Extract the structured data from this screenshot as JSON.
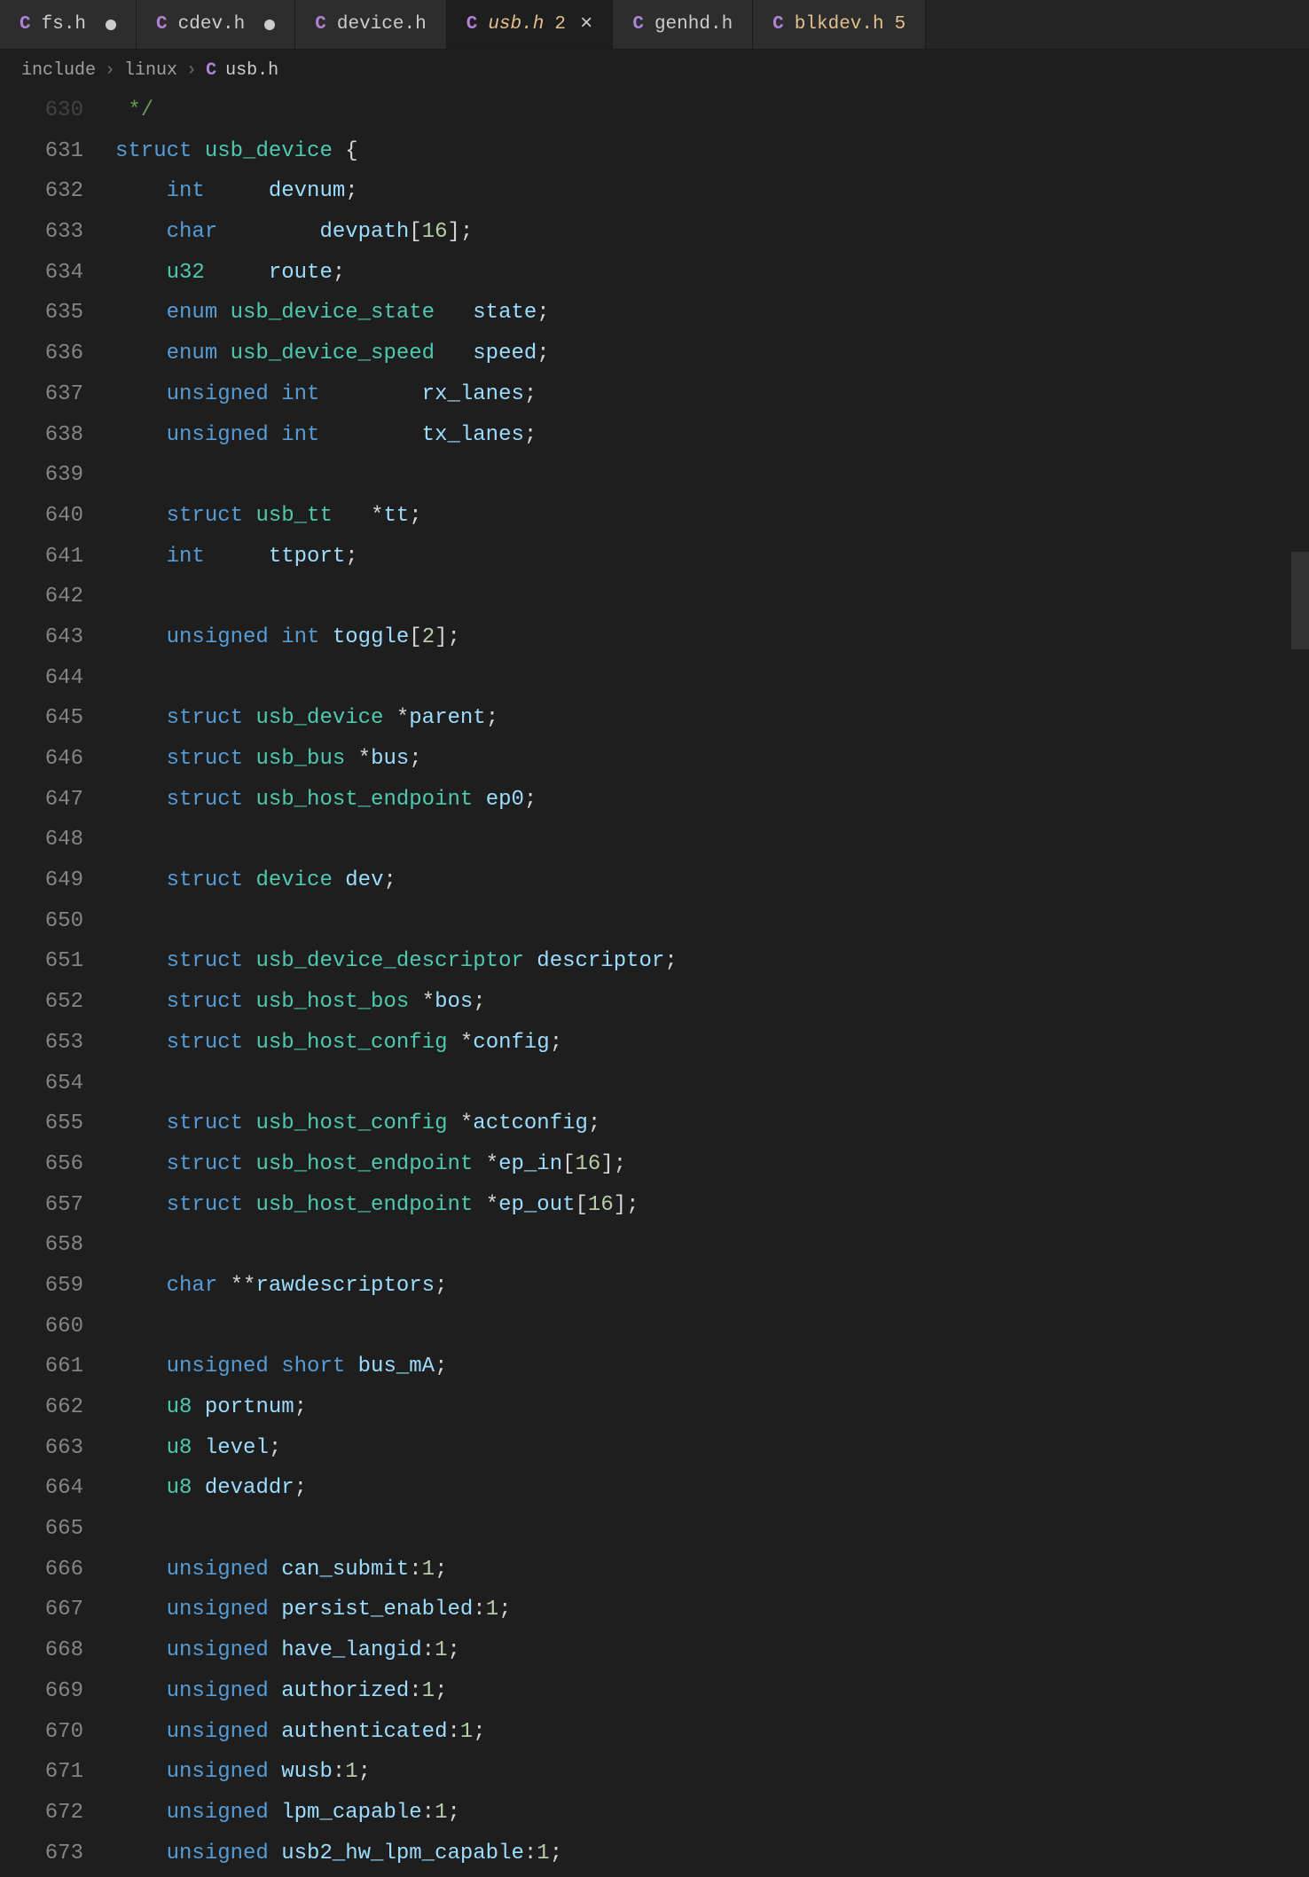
{
  "tabs": [
    {
      "icon": "C",
      "name": "fs.h",
      "modified": true,
      "badge": "",
      "active": false,
      "close": false
    },
    {
      "icon": "C",
      "name": "cdev.h",
      "modified": true,
      "badge": "",
      "active": false,
      "close": false
    },
    {
      "icon": "C",
      "name": "device.h",
      "modified": false,
      "badge": "",
      "active": false,
      "close": false
    },
    {
      "icon": "C",
      "name": "usb.h",
      "modified": false,
      "badge": "2",
      "active": true,
      "close": true
    },
    {
      "icon": "C",
      "name": "genhd.h",
      "modified": false,
      "badge": "",
      "active": false,
      "close": false
    },
    {
      "icon": "C",
      "name": "blkdev.h",
      "modified": false,
      "badge": "5",
      "active": false,
      "close": false
    }
  ],
  "breadcrumbs": {
    "part0": "include",
    "part1": "linux",
    "fileIcon": "C",
    "file": "usb.h",
    "sep": "›"
  },
  "lineStart": 630,
  "code": [
    {
      "n": 630,
      "faded": true,
      "tokens": [
        [
          "comment",
          " */"
        ]
      ]
    },
    {
      "n": 631,
      "tokens": [
        [
          "kw",
          "struct"
        ],
        [
          "sp",
          " "
        ],
        [
          "type",
          "usb_device"
        ],
        [
          "sp",
          " "
        ],
        [
          "punc",
          "{"
        ]
      ]
    },
    {
      "n": 632,
      "indent": 1,
      "tokens": [
        [
          "kw",
          "int"
        ],
        [
          "sp",
          "     "
        ],
        [
          "field",
          "devnum"
        ],
        [
          "punc",
          ";"
        ]
      ]
    },
    {
      "n": 633,
      "indent": 1,
      "tokens": [
        [
          "kw",
          "char"
        ],
        [
          "sp",
          "        "
        ],
        [
          "field",
          "devpath"
        ],
        [
          "punc",
          "["
        ],
        [
          "num",
          "16"
        ],
        [
          "punc",
          "]"
        ],
        [
          "punc",
          ";"
        ]
      ]
    },
    {
      "n": 634,
      "indent": 1,
      "tokens": [
        [
          "typealias",
          "u32"
        ],
        [
          "sp",
          "     "
        ],
        [
          "field",
          "route"
        ],
        [
          "punc",
          ";"
        ]
      ]
    },
    {
      "n": 635,
      "indent": 1,
      "tokens": [
        [
          "kw",
          "enum"
        ],
        [
          "sp",
          " "
        ],
        [
          "type",
          "usb_device_state"
        ],
        [
          "sp",
          "   "
        ],
        [
          "field",
          "state"
        ],
        [
          "punc",
          ";"
        ]
      ]
    },
    {
      "n": 636,
      "indent": 1,
      "tokens": [
        [
          "kw",
          "enum"
        ],
        [
          "sp",
          " "
        ],
        [
          "type",
          "usb_device_speed"
        ],
        [
          "sp",
          "   "
        ],
        [
          "field",
          "speed"
        ],
        [
          "punc",
          ";"
        ]
      ]
    },
    {
      "n": 637,
      "indent": 1,
      "tokens": [
        [
          "kw",
          "unsigned"
        ],
        [
          "sp",
          " "
        ],
        [
          "kw",
          "int"
        ],
        [
          "sp",
          "        "
        ],
        [
          "field",
          "rx_lanes"
        ],
        [
          "punc",
          ";"
        ]
      ]
    },
    {
      "n": 638,
      "indent": 1,
      "tokens": [
        [
          "kw",
          "unsigned"
        ],
        [
          "sp",
          " "
        ],
        [
          "kw",
          "int"
        ],
        [
          "sp",
          "        "
        ],
        [
          "field",
          "tx_lanes"
        ],
        [
          "punc",
          ";"
        ]
      ]
    },
    {
      "n": 639,
      "indent": 1,
      "tokens": []
    },
    {
      "n": 640,
      "indent": 1,
      "tokens": [
        [
          "kw",
          "struct"
        ],
        [
          "sp",
          " "
        ],
        [
          "type",
          "usb_tt"
        ],
        [
          "sp",
          "   "
        ],
        [
          "op",
          "*"
        ],
        [
          "field",
          "tt"
        ],
        [
          "punc",
          ";"
        ]
      ]
    },
    {
      "n": 641,
      "indent": 1,
      "tokens": [
        [
          "kw",
          "int"
        ],
        [
          "sp",
          "     "
        ],
        [
          "field",
          "ttport"
        ],
        [
          "punc",
          ";"
        ]
      ]
    },
    {
      "n": 642,
      "indent": 1,
      "tokens": []
    },
    {
      "n": 643,
      "indent": 1,
      "tokens": [
        [
          "kw",
          "unsigned"
        ],
        [
          "sp",
          " "
        ],
        [
          "kw",
          "int"
        ],
        [
          "sp",
          " "
        ],
        [
          "field",
          "toggle"
        ],
        [
          "punc",
          "["
        ],
        [
          "num",
          "2"
        ],
        [
          "punc",
          "]"
        ],
        [
          "punc",
          ";"
        ]
      ]
    },
    {
      "n": 644,
      "indent": 1,
      "tokens": []
    },
    {
      "n": 645,
      "indent": 1,
      "tokens": [
        [
          "kw",
          "struct"
        ],
        [
          "sp",
          " "
        ],
        [
          "type",
          "usb_device"
        ],
        [
          "sp",
          " "
        ],
        [
          "op",
          "*"
        ],
        [
          "field",
          "parent"
        ],
        [
          "punc",
          ";"
        ]
      ]
    },
    {
      "n": 646,
      "indent": 1,
      "tokens": [
        [
          "kw",
          "struct"
        ],
        [
          "sp",
          " "
        ],
        [
          "type",
          "usb_bus"
        ],
        [
          "sp",
          " "
        ],
        [
          "op",
          "*"
        ],
        [
          "field",
          "bus"
        ],
        [
          "punc",
          ";"
        ]
      ]
    },
    {
      "n": 647,
      "indent": 1,
      "tokens": [
        [
          "kw",
          "struct"
        ],
        [
          "sp",
          " "
        ],
        [
          "type",
          "usb_host_endpoint"
        ],
        [
          "sp",
          " "
        ],
        [
          "field",
          "ep0"
        ],
        [
          "punc",
          ";"
        ]
      ]
    },
    {
      "n": 648,
      "indent": 1,
      "tokens": []
    },
    {
      "n": 649,
      "indent": 1,
      "tokens": [
        [
          "kw",
          "struct"
        ],
        [
          "sp",
          " "
        ],
        [
          "type",
          "device"
        ],
        [
          "sp",
          " "
        ],
        [
          "field",
          "dev"
        ],
        [
          "punc",
          ";"
        ]
      ]
    },
    {
      "n": 650,
      "indent": 1,
      "tokens": []
    },
    {
      "n": 651,
      "indent": 1,
      "tokens": [
        [
          "kw",
          "struct"
        ],
        [
          "sp",
          " "
        ],
        [
          "type",
          "usb_device_descriptor"
        ],
        [
          "sp",
          " "
        ],
        [
          "field",
          "descriptor"
        ],
        [
          "punc",
          ";"
        ]
      ]
    },
    {
      "n": 652,
      "indent": 1,
      "tokens": [
        [
          "kw",
          "struct"
        ],
        [
          "sp",
          " "
        ],
        [
          "type",
          "usb_host_bos"
        ],
        [
          "sp",
          " "
        ],
        [
          "op",
          "*"
        ],
        [
          "field",
          "bos"
        ],
        [
          "punc",
          ";"
        ]
      ]
    },
    {
      "n": 653,
      "indent": 1,
      "tokens": [
        [
          "kw",
          "struct"
        ],
        [
          "sp",
          " "
        ],
        [
          "type",
          "usb_host_config"
        ],
        [
          "sp",
          " "
        ],
        [
          "op",
          "*"
        ],
        [
          "field",
          "config"
        ],
        [
          "punc",
          ";"
        ]
      ]
    },
    {
      "n": 654,
      "indent": 1,
      "tokens": []
    },
    {
      "n": 655,
      "indent": 1,
      "tokens": [
        [
          "kw",
          "struct"
        ],
        [
          "sp",
          " "
        ],
        [
          "type",
          "usb_host_config"
        ],
        [
          "sp",
          " "
        ],
        [
          "op",
          "*"
        ],
        [
          "field",
          "actconfig"
        ],
        [
          "punc",
          ";"
        ]
      ]
    },
    {
      "n": 656,
      "indent": 1,
      "tokens": [
        [
          "kw",
          "struct"
        ],
        [
          "sp",
          " "
        ],
        [
          "type",
          "usb_host_endpoint"
        ],
        [
          "sp",
          " "
        ],
        [
          "op",
          "*"
        ],
        [
          "field",
          "ep_in"
        ],
        [
          "punc",
          "["
        ],
        [
          "num",
          "16"
        ],
        [
          "punc",
          "]"
        ],
        [
          "punc",
          ";"
        ]
      ]
    },
    {
      "n": 657,
      "indent": 1,
      "tokens": [
        [
          "kw",
          "struct"
        ],
        [
          "sp",
          " "
        ],
        [
          "type",
          "usb_host_endpoint"
        ],
        [
          "sp",
          " "
        ],
        [
          "op",
          "*"
        ],
        [
          "field",
          "ep_out"
        ],
        [
          "punc",
          "["
        ],
        [
          "num",
          "16"
        ],
        [
          "punc",
          "]"
        ],
        [
          "punc",
          ";"
        ]
      ]
    },
    {
      "n": 658,
      "indent": 1,
      "tokens": []
    },
    {
      "n": 659,
      "indent": 1,
      "tokens": [
        [
          "kw",
          "char"
        ],
        [
          "sp",
          " "
        ],
        [
          "op",
          "**"
        ],
        [
          "field",
          "rawdescriptors"
        ],
        [
          "punc",
          ";"
        ]
      ]
    },
    {
      "n": 660,
      "indent": 1,
      "tokens": []
    },
    {
      "n": 661,
      "indent": 1,
      "tokens": [
        [
          "kw",
          "unsigned"
        ],
        [
          "sp",
          " "
        ],
        [
          "kw",
          "short"
        ],
        [
          "sp",
          " "
        ],
        [
          "field",
          "bus_mA"
        ],
        [
          "punc",
          ";"
        ]
      ]
    },
    {
      "n": 662,
      "indent": 1,
      "tokens": [
        [
          "typealias",
          "u8"
        ],
        [
          "sp",
          " "
        ],
        [
          "field",
          "portnum"
        ],
        [
          "punc",
          ";"
        ]
      ]
    },
    {
      "n": 663,
      "indent": 1,
      "tokens": [
        [
          "typealias",
          "u8"
        ],
        [
          "sp",
          " "
        ],
        [
          "field",
          "level"
        ],
        [
          "punc",
          ";"
        ]
      ]
    },
    {
      "n": 664,
      "indent": 1,
      "tokens": [
        [
          "typealias",
          "u8"
        ],
        [
          "sp",
          " "
        ],
        [
          "field",
          "devaddr"
        ],
        [
          "punc",
          ";"
        ]
      ]
    },
    {
      "n": 665,
      "indent": 1,
      "tokens": []
    },
    {
      "n": 666,
      "indent": 1,
      "tokens": [
        [
          "kw",
          "unsigned"
        ],
        [
          "sp",
          " "
        ],
        [
          "field",
          "can_submit"
        ],
        [
          "punc",
          ":"
        ],
        [
          "num",
          "1"
        ],
        [
          "punc",
          ";"
        ]
      ]
    },
    {
      "n": 667,
      "indent": 1,
      "tokens": [
        [
          "kw",
          "unsigned"
        ],
        [
          "sp",
          " "
        ],
        [
          "field",
          "persist_enabled"
        ],
        [
          "punc",
          ":"
        ],
        [
          "num",
          "1"
        ],
        [
          "punc",
          ";"
        ]
      ]
    },
    {
      "n": 668,
      "indent": 1,
      "tokens": [
        [
          "kw",
          "unsigned"
        ],
        [
          "sp",
          " "
        ],
        [
          "field",
          "have_langid"
        ],
        [
          "punc",
          ":"
        ],
        [
          "num",
          "1"
        ],
        [
          "punc",
          ";"
        ]
      ]
    },
    {
      "n": 669,
      "indent": 1,
      "tokens": [
        [
          "kw",
          "unsigned"
        ],
        [
          "sp",
          " "
        ],
        [
          "field",
          "authorized"
        ],
        [
          "punc",
          ":"
        ],
        [
          "num",
          "1"
        ],
        [
          "punc",
          ";"
        ]
      ]
    },
    {
      "n": 670,
      "indent": 1,
      "tokens": [
        [
          "kw",
          "unsigned"
        ],
        [
          "sp",
          " "
        ],
        [
          "field",
          "authenticated"
        ],
        [
          "punc",
          ":"
        ],
        [
          "num",
          "1"
        ],
        [
          "punc",
          ";"
        ]
      ]
    },
    {
      "n": 671,
      "indent": 1,
      "tokens": [
        [
          "kw",
          "unsigned"
        ],
        [
          "sp",
          " "
        ],
        [
          "field",
          "wusb"
        ],
        [
          "punc",
          ":"
        ],
        [
          "num",
          "1"
        ],
        [
          "punc",
          ";"
        ]
      ]
    },
    {
      "n": 672,
      "indent": 1,
      "tokens": [
        [
          "kw",
          "unsigned"
        ],
        [
          "sp",
          " "
        ],
        [
          "field",
          "lpm_capable"
        ],
        [
          "punc",
          ":"
        ],
        [
          "num",
          "1"
        ],
        [
          "punc",
          ";"
        ]
      ]
    },
    {
      "n": 673,
      "indent": 1,
      "tokens": [
        [
          "kw",
          "unsigned"
        ],
        [
          "sp",
          " "
        ],
        [
          "field",
          "usb2_hw_lpm_capable"
        ],
        [
          "punc",
          ":"
        ],
        [
          "num",
          "1"
        ],
        [
          "punc",
          ";"
        ]
      ]
    }
  ]
}
